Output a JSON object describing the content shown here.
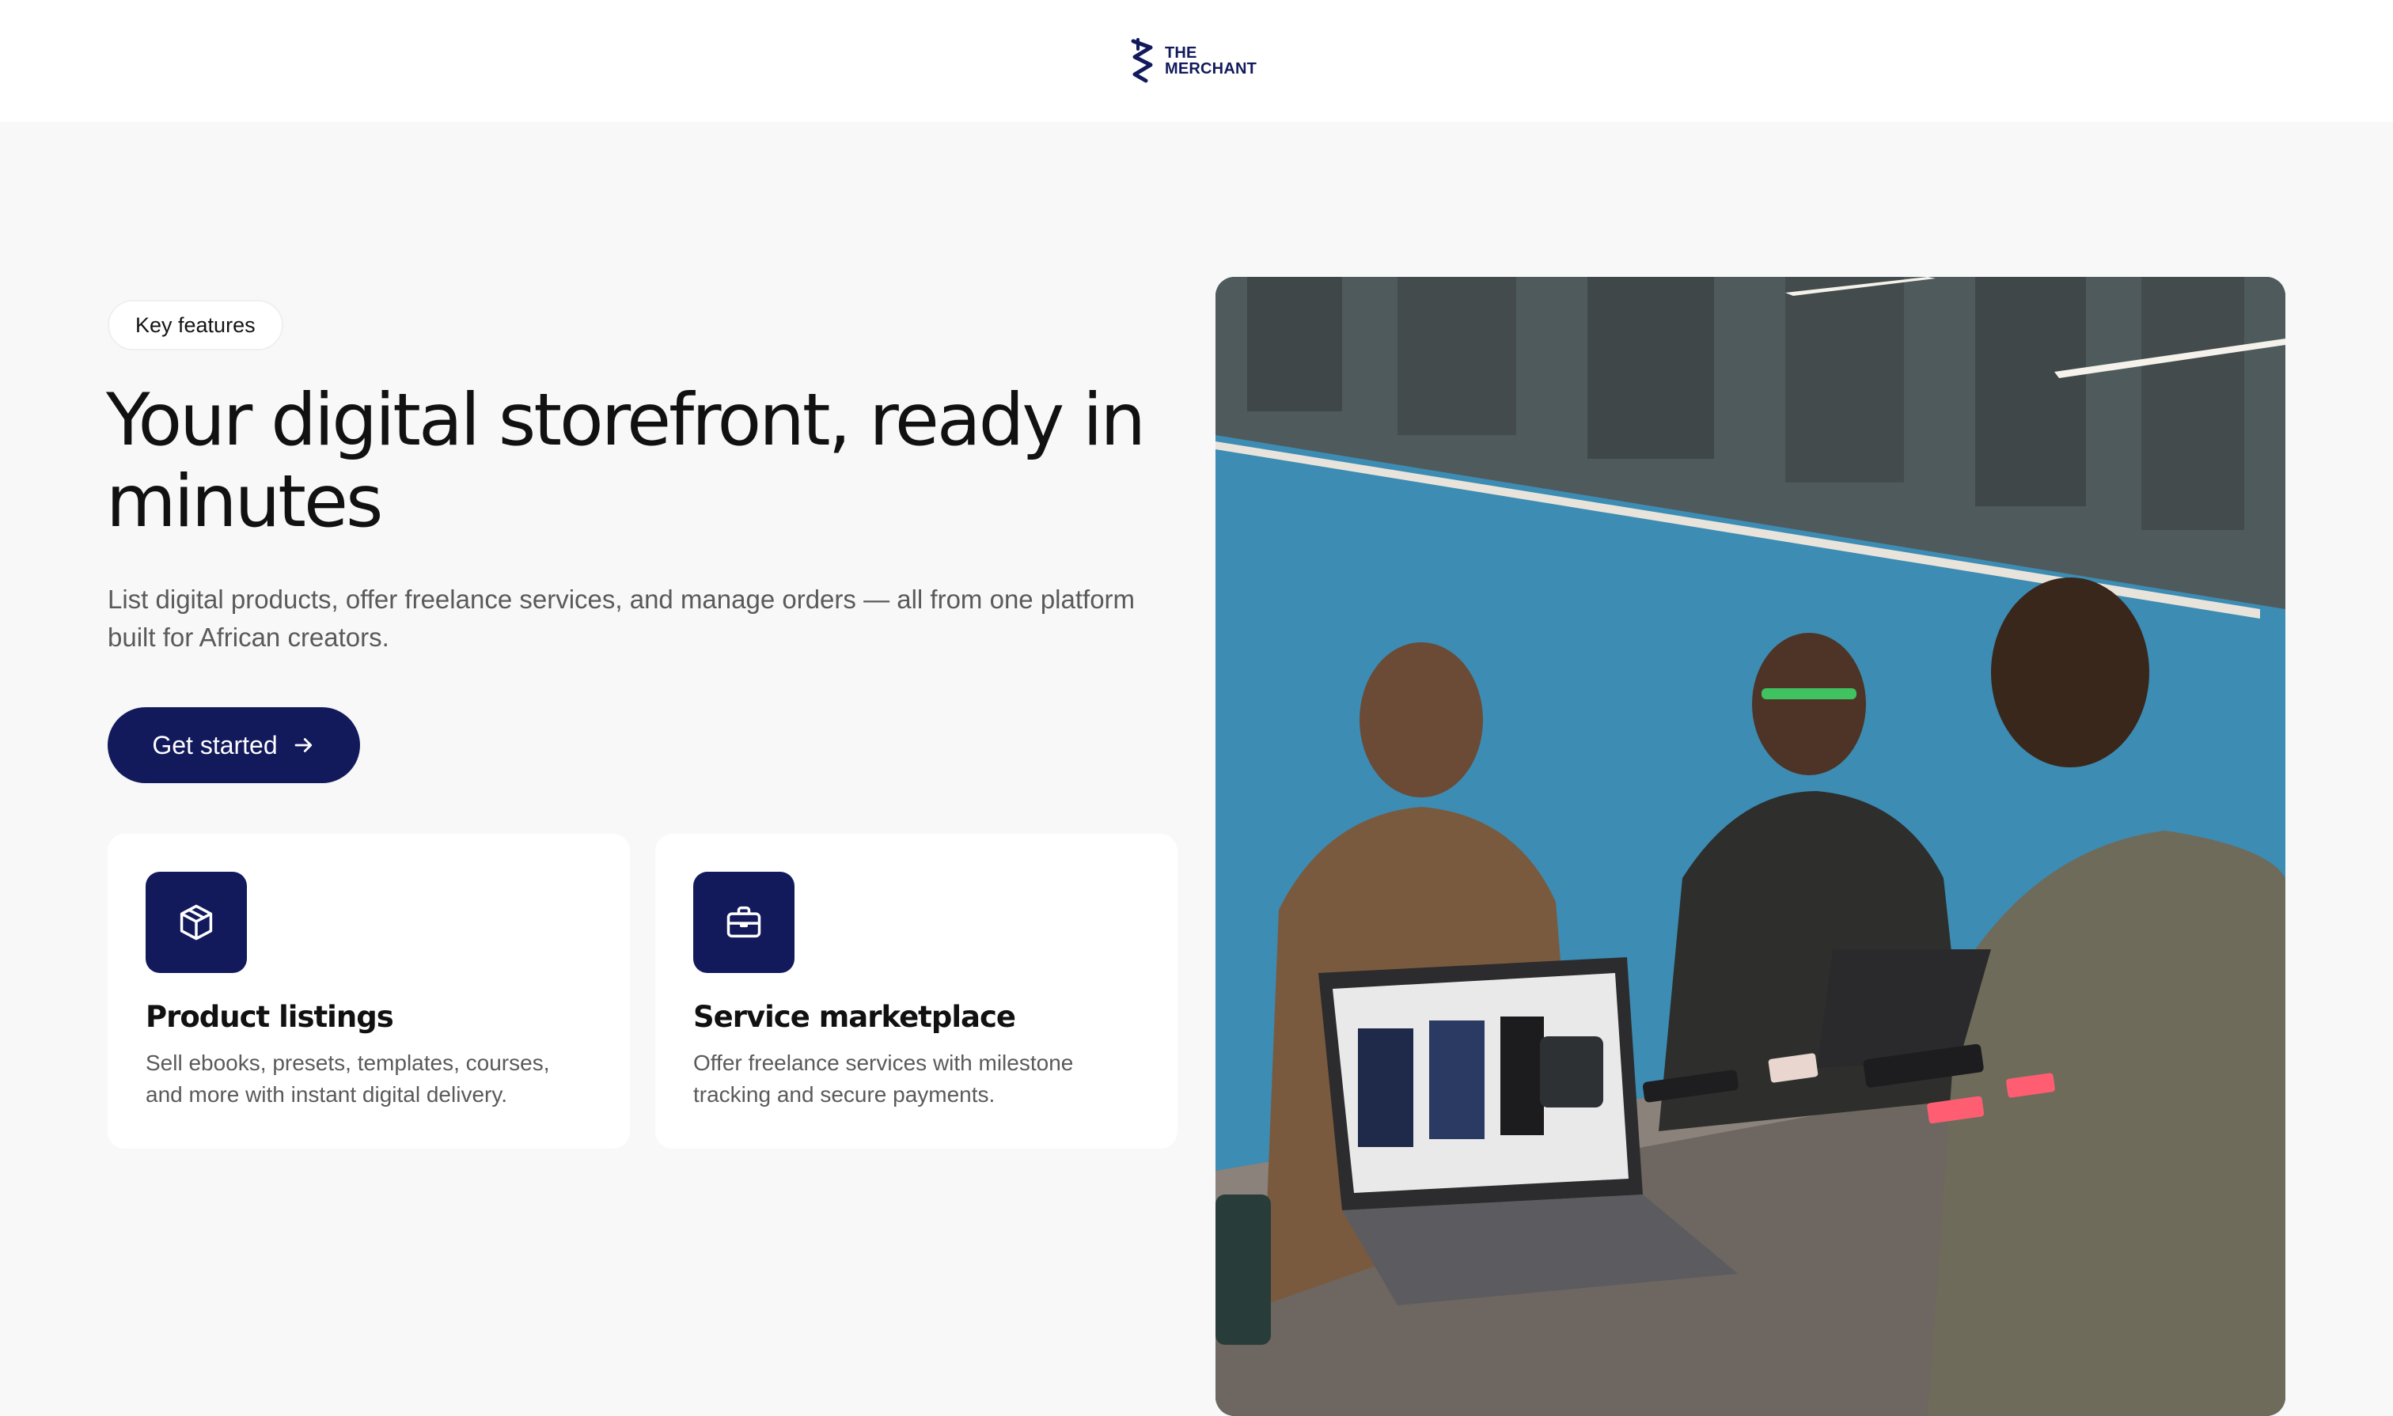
{
  "brand": {
    "logo_line1": "THE",
    "logo_line2": "MERCHANT",
    "color": "#121a5c"
  },
  "hero": {
    "badge": "Key features",
    "title": "Your digital storefront, ready in minutes",
    "subtitle": "List digital products, offer freelance services, and manage orders — all from one platform built for African creators.",
    "cta_label": "Get started",
    "cta_icon": "arrow-right-icon"
  },
  "features": [
    {
      "icon": "package-icon",
      "title": "Product listings",
      "description": "Sell ebooks, presets, templates, courses, and more with instant digital delivery."
    },
    {
      "icon": "briefcase-icon",
      "title": "Service marketplace",
      "description": "Offer freelance services with milestone tracking and secure payments."
    }
  ],
  "image": {
    "subject": "three-people-at-tech-store-counter-photo"
  }
}
